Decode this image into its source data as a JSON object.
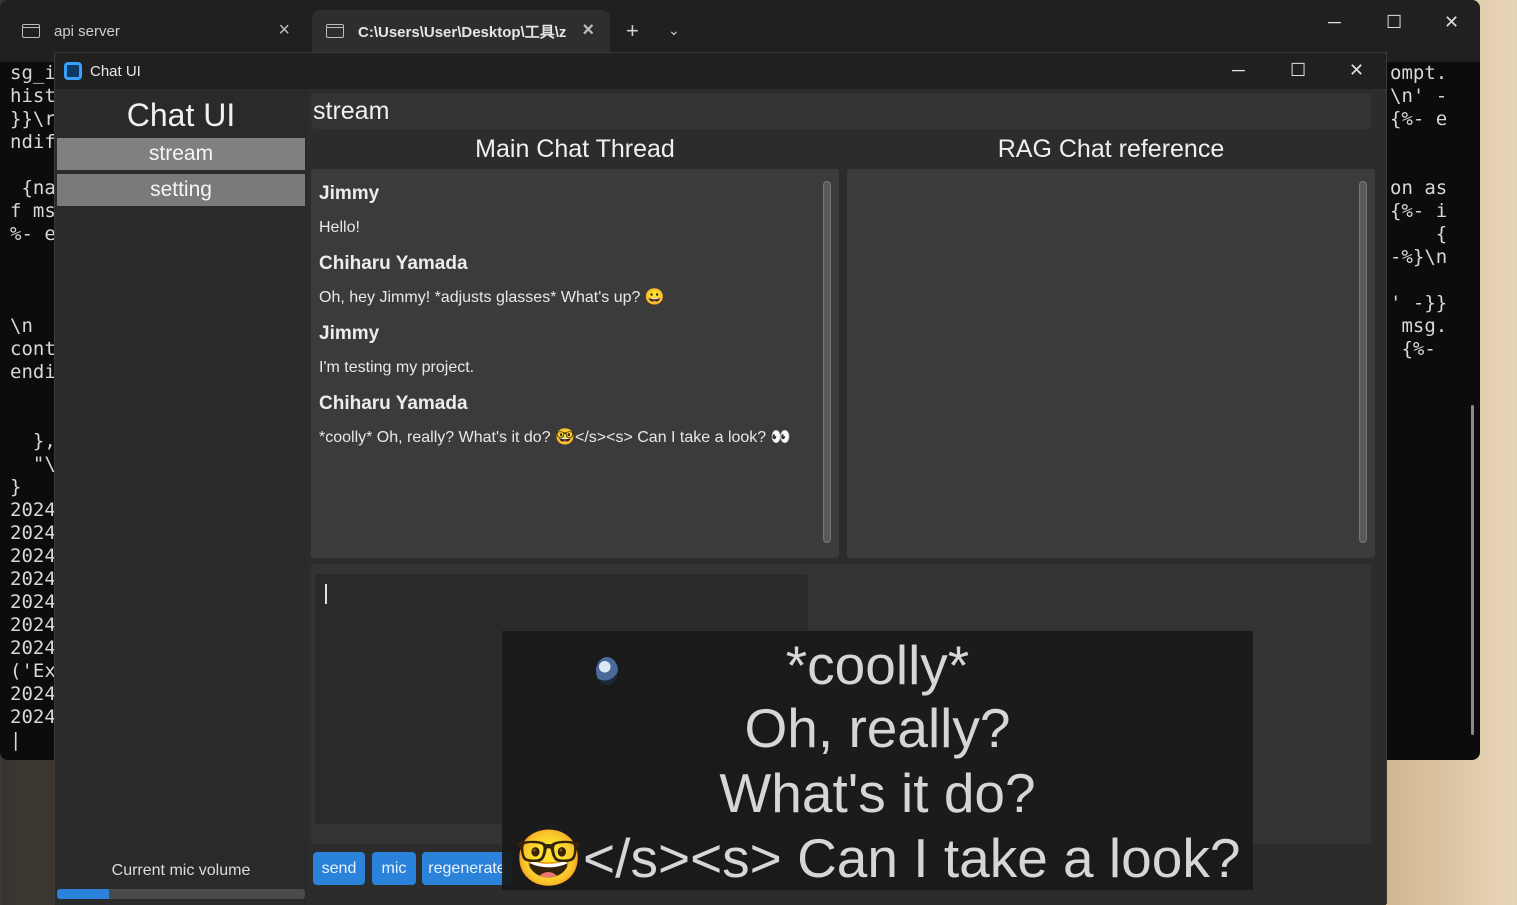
{
  "terminal": {
    "tabs": [
      {
        "label": "api server",
        "active": false
      },
      {
        "label": "C:\\Users\\User\\Desktop\\工具\\z",
        "active": true
      }
    ],
    "add_tab": "+",
    "dropdown": "⌄",
    "minimize": "─",
    "maximize": "☐",
    "close": "✕",
    "left_text": "sg_i\nhist\n}}\\r\nndif\n\n {na\nf ms\n%- e\n\n\n\n\\n\ncont\nendi\n\n\n  },\n  \"\\\n}\n2024\n2024\n2024\n2024\n2024\n2024\n2024\n('Ex\n2024\n2024\n|",
    "right_text": "ompt.\n\\n' -\n{%- e\n\n\non as\n{%- i\n    {\n-%}\\n\n\n' -}}\n msg.\n {%-"
  },
  "window": {
    "title": "Chat UI",
    "minimize": "─",
    "maximize": "☐",
    "close": "✕"
  },
  "sidebar": {
    "title": "Chat UI",
    "items": [
      {
        "label": "stream",
        "selected": true
      },
      {
        "label": "setting",
        "selected": false
      }
    ],
    "mic_label": "Current mic volume",
    "mic_level": 0.21
  },
  "page": {
    "header": "stream",
    "main_title": "Main Chat Thread",
    "rag_title": "RAG Chat reference"
  },
  "messages": [
    {
      "speaker": "Jimmy",
      "text": "Hello!"
    },
    {
      "speaker": "Chiharu Yamada",
      "text": "Oh, hey Jimmy! *adjusts glasses* What's up? 😀"
    },
    {
      "speaker": "Jimmy",
      "text": "I'm testing my project."
    },
    {
      "speaker": "Chiharu Yamada",
      "text": "*coolly* Oh, really? What's it do? 🤓</s><s> Can I take a look? 👀"
    }
  ],
  "input": {
    "value": ""
  },
  "buttons": [
    {
      "label": "send"
    },
    {
      "label": "mic"
    },
    {
      "label": "regenerate"
    }
  ],
  "overlay": {
    "lines": [
      "*coolly*",
      "Oh, really?",
      "What's it do?",
      "🤓</s><s> Can I take a look?"
    ]
  },
  "colors": {
    "accent": "#2a82da",
    "panel": "#3b3b3b",
    "nav_button": "#7a7a7a"
  }
}
